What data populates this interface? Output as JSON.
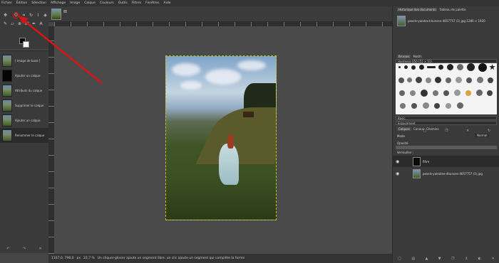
{
  "menu": [
    "Fichier",
    "Édition",
    "Sélection",
    "Affichage",
    "Image",
    "Calque",
    "Couleurs",
    "Outils",
    "Filtres",
    "Fenêtres",
    "Aide"
  ],
  "history": {
    "items": [
      {
        "label": "[ Image de base ]",
        "thumb": "photo"
      },
      {
        "label": "Ajouter un calque",
        "thumb": "black"
      },
      {
        "label": "Attributs du calque",
        "thumb": "photo"
      },
      {
        "label": "Supprimer le calque",
        "thumb": "photo"
      },
      {
        "label": "Ajouter un calque",
        "thumb": "photo"
      },
      {
        "label": "Renommer le calque",
        "thumb": "photo",
        "selected": true
      }
    ]
  },
  "status": {
    "coords": "1167,0, 798,0",
    "unit": "px",
    "zoom": "22,7 %",
    "message": "Un cliquer-glisser ajoute un segment libre, un clic ajoute un segment qui complète la forme"
  },
  "dock": {
    "top_tabs": [
      "Historique des documents",
      "Tableau de palette"
    ],
    "document_name": "pexels-yandex-khunsen-4657757 (1).jpg-1280 × 1920",
    "brush_tabs": [
      "Brosses",
      "Motifs"
    ],
    "brush_filter": "Hardness 050 (51 × 51)",
    "brush_tag": "Basic,",
    "brush_spacing": "Espacement",
    "layer_tabs": [
      "Calques",
      "Canaux",
      "Chemins"
    ],
    "mode_label": "Mode",
    "mode_value": "Normal",
    "opacity_label": "Opacité",
    "lock_label": "Verrouiller :",
    "layers": [
      {
        "name": "filtre",
        "selected": true
      },
      {
        "name": "pexels-yamalee-dhunsen-4657757 (1).jpg"
      }
    ]
  },
  "icons": {
    "active_tool": "free-select-lasso-icon",
    "annotation": "red-arrow-annotation"
  }
}
